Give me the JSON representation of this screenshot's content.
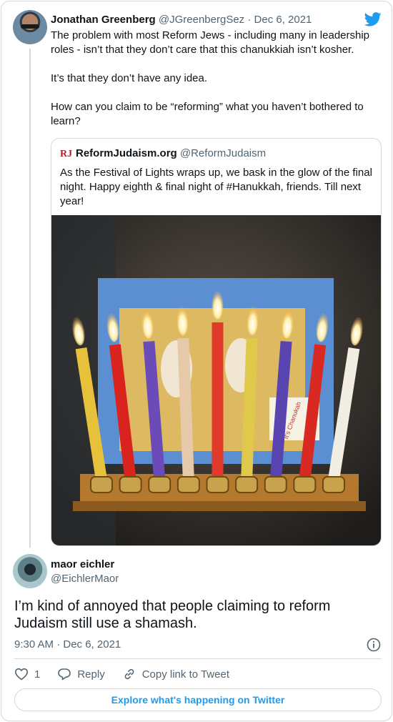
{
  "tweet": {
    "author_name": "Jonathan Greenberg",
    "author_handle": "@JGreenbergSez",
    "separator": " · ",
    "date": "Dec 6, 2021",
    "paragraphs": [
      "The problem with most Reform Jews - including many in leadership roles - isn’t that they don’t care that this chanukkiah isn’t kosher.",
      "It’s that they don’t have any idea.",
      "How can you claim to be “reforming” what you haven’t bothered to learn?"
    ]
  },
  "quoted": {
    "logo_text": "RJ",
    "name": "ReformJudaism.org",
    "handle": "@ReformJudaism",
    "text": "As the Festival of Lights wraps up, we bask in the glow of the final night. Happy eighth & final night of #Hanukkah, friends. Till next year!",
    "candle_colors": [
      "#e8c13a",
      "#d8231e",
      "#6a4bb8",
      "#e6c9a8",
      "#e23a2a",
      "#e0c94a",
      "#5a44b0",
      "#d82a22",
      "#f1ede2"
    ],
    "photo_sign_text": "It's Chanukah"
  },
  "reply": {
    "author_name": "maor eichler",
    "author_handle": "@EichlerMaor",
    "text": "I’m kind of annoyed that people claiming to reform Judaism still use a shamash.",
    "timestamp": "9:30 AM · Dec 6, 2021"
  },
  "actions": {
    "like_count": "1",
    "reply_label": "Reply",
    "copy_label": "Copy link to Tweet"
  },
  "explore_label": "Explore what's happening on Twitter",
  "colors": {
    "accent": "#1d9bf0",
    "text": "#0f1419",
    "muted": "#536471",
    "border": "#cfd9de"
  }
}
